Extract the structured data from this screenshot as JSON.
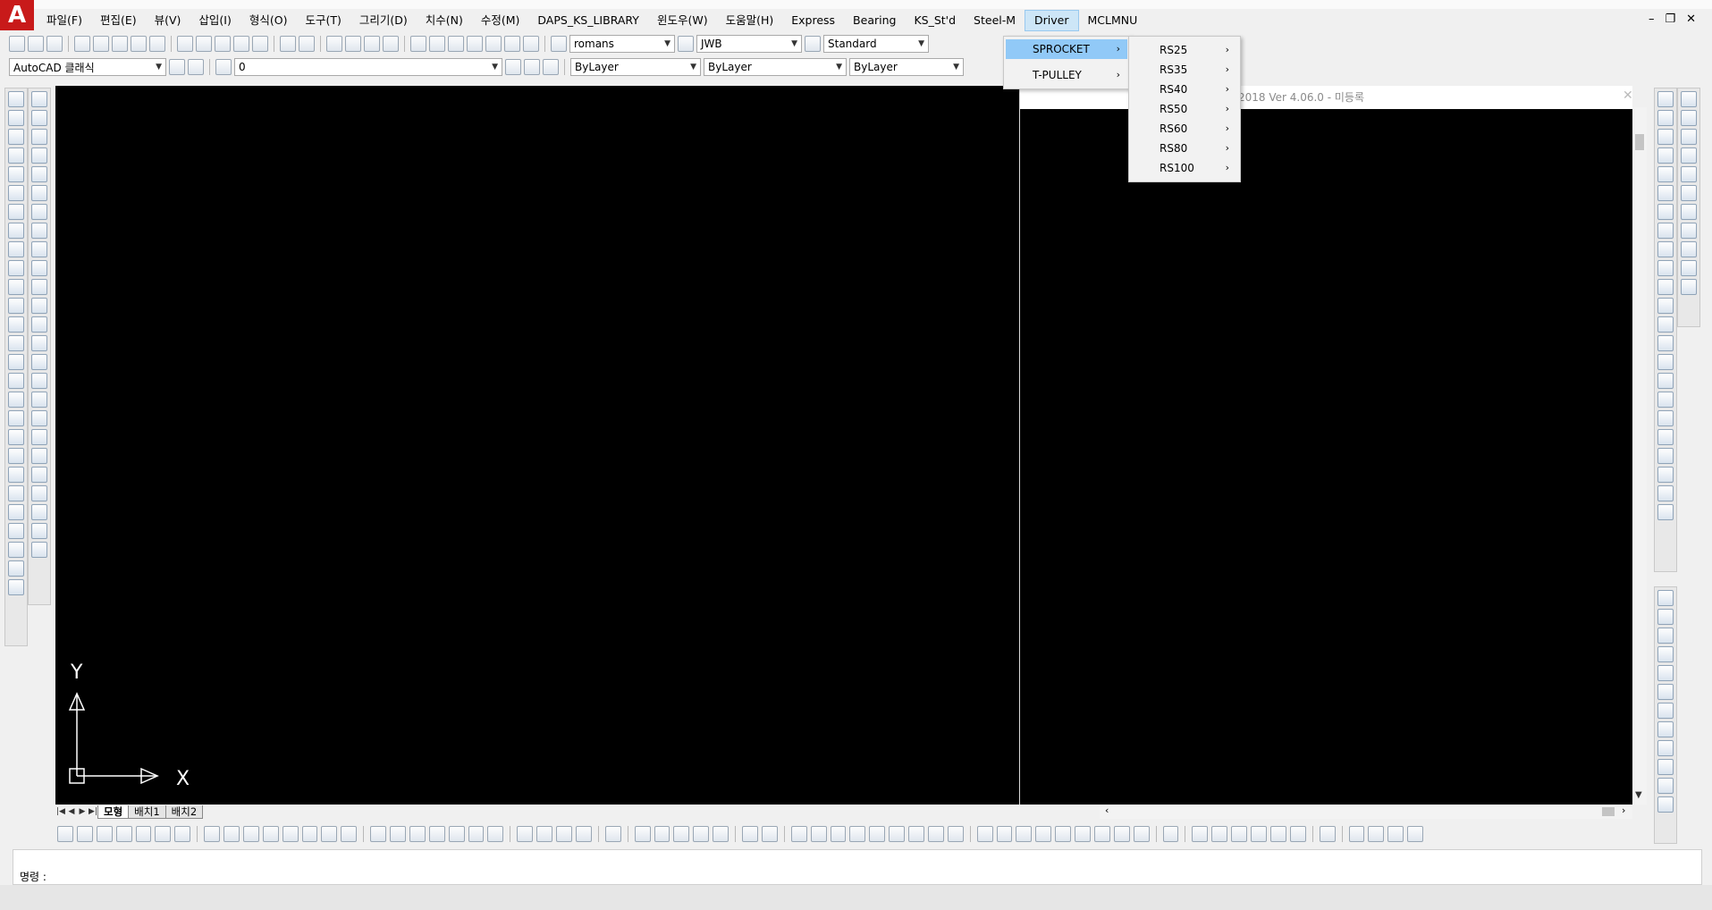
{
  "menubar": {
    "items": [
      "파일(F)",
      "편집(E)",
      "뷰(V)",
      "삽입(I)",
      "형식(O)",
      "도구(T)",
      "그리기(D)",
      "치수(N)",
      "수정(M)",
      "DAPS_KS_LIBRARY",
      "윈도우(W)",
      "도움말(H)",
      "Express",
      "Bearing",
      "KS_St'd",
      "Steel-M",
      "Driver",
      "MCLMNU"
    ],
    "active": "Driver"
  },
  "window_controls": {
    "minimize": "–",
    "restore": "❐",
    "close": "✕"
  },
  "toolbar_top": {
    "text_style": "romans",
    "dim_style": "JWB",
    "table_style": "Standard"
  },
  "toolbar_second": {
    "workspace": "AutoCAD 클래식",
    "layer": "0",
    "color": "ByLayer",
    "linetype": "ByLayer",
    "lineweight": "ByLayer"
  },
  "document": {
    "title_fragment": "2018  Ver 4.06.0 - 미등록"
  },
  "ucs": {
    "x_label": "X",
    "y_label": "Y"
  },
  "layout_tabs": {
    "items": [
      "모형",
      "배치1",
      "배치2"
    ],
    "active": "모형"
  },
  "command": {
    "prompt": "명령 :"
  },
  "driver_menu": {
    "items": [
      {
        "label": "SPROCKET",
        "has_submenu": true,
        "highlighted": true
      },
      {
        "label": "T-PULLEY",
        "has_submenu": true,
        "highlighted": false
      }
    ]
  },
  "sprocket_submenu": {
    "items": [
      "RS25",
      "RS35",
      "RS40",
      "RS50",
      "RS60",
      "RS80",
      "RS100"
    ]
  },
  "colors": {
    "canvas": "#000000",
    "menu_highlight": "#91c9f7",
    "app_logo": "#c81a1a"
  }
}
